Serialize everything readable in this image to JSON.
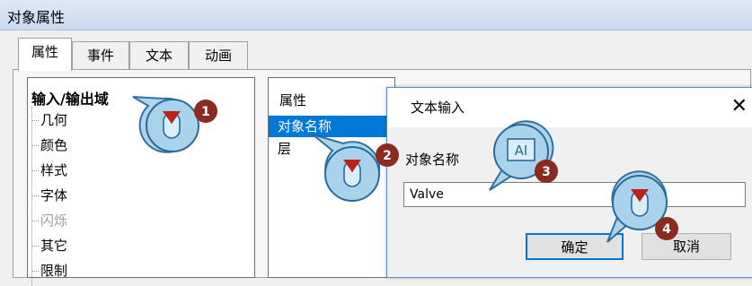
{
  "window": {
    "title": "对象属性"
  },
  "tabs": [
    {
      "label": "属性"
    },
    {
      "label": "事件"
    },
    {
      "label": "文本"
    },
    {
      "label": "动画"
    }
  ],
  "tree": {
    "root": "输入/输出域",
    "items": [
      {
        "label": "几何"
      },
      {
        "label": "颜色"
      },
      {
        "label": "样式"
      },
      {
        "label": "字体"
      },
      {
        "label": "闪烁"
      },
      {
        "label": "其它"
      },
      {
        "label": "限制"
      }
    ]
  },
  "property_list": {
    "header": "属性",
    "selected": "对象名称",
    "other": "层"
  },
  "dialog": {
    "title": "文本输入",
    "close_glyph": "✕",
    "field_label": "对象名称",
    "field_value": "Valve",
    "ok_label": "确定",
    "cancel_label": "取消"
  },
  "callouts": {
    "step1": "1",
    "step2": "2",
    "step3": "3",
    "step4": "4",
    "text_input_glyph": "AI"
  },
  "colors": {
    "selection": "#0078d7",
    "callout_fill": "#a9d3ec",
    "callout_stroke": "#2a6a9a",
    "badge": "#8b2a1e",
    "pointer": "#b8241c"
  }
}
